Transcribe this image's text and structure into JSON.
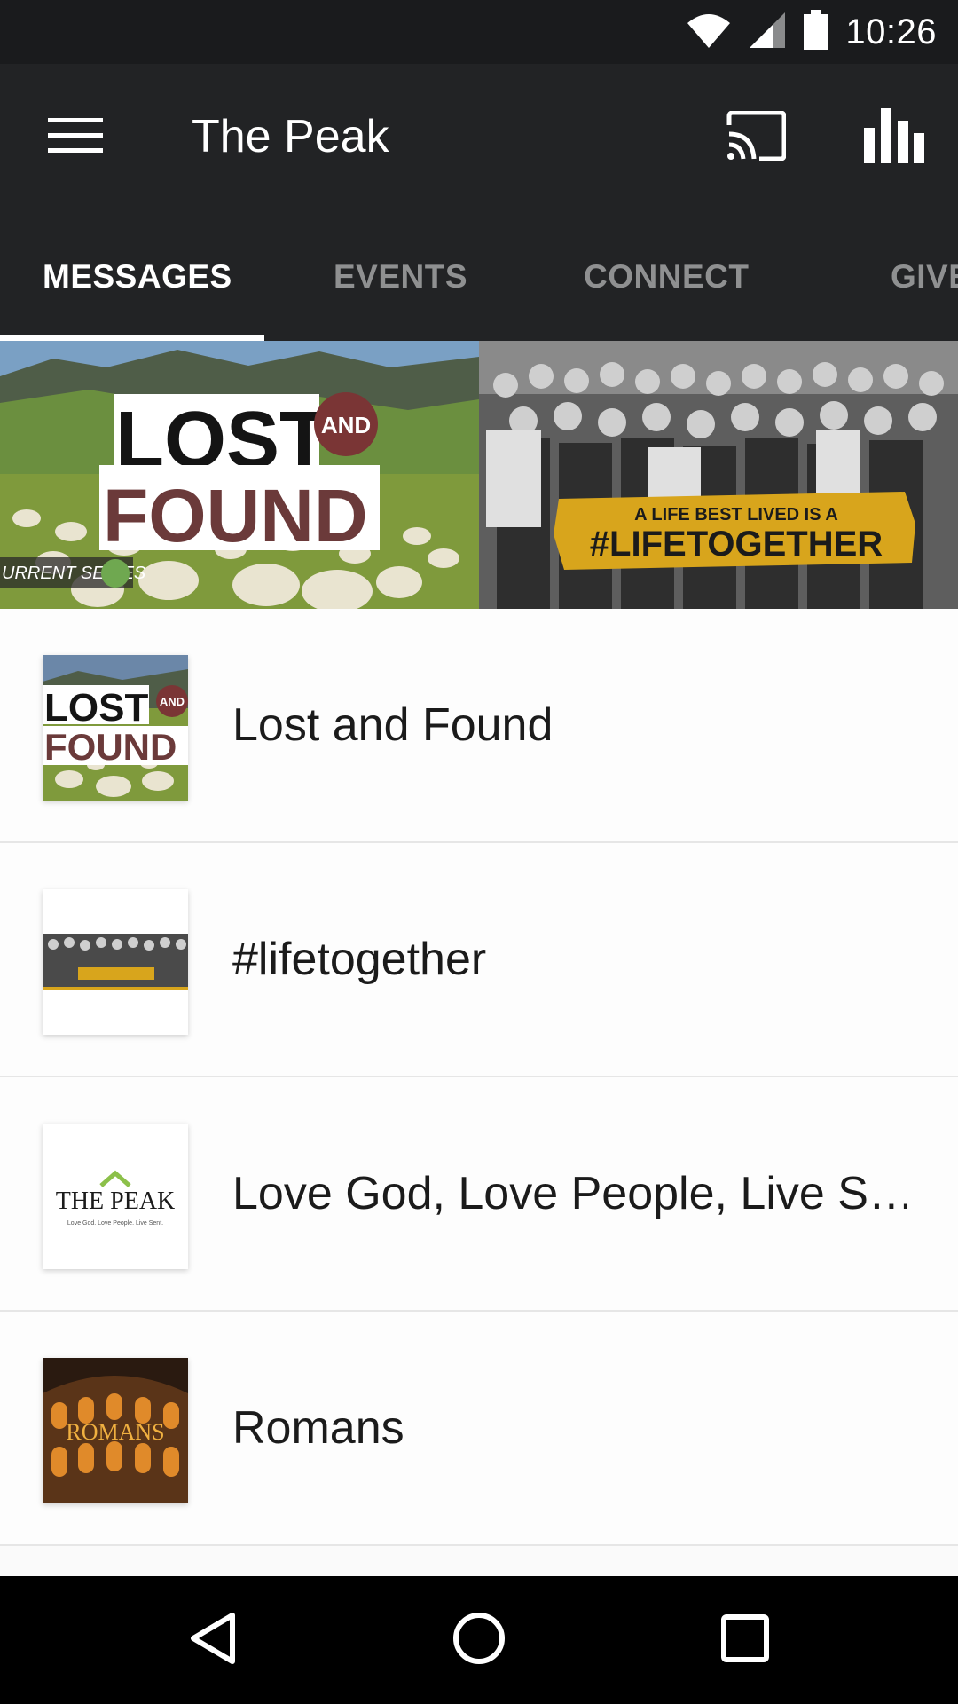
{
  "status_bar": {
    "time": "10:26",
    "icons": [
      "wifi-icon",
      "cell-signal-icon",
      "battery-icon"
    ]
  },
  "app_bar": {
    "title": "The Peak",
    "icons": [
      "menu-icon",
      "cast-icon",
      "bar-chart-icon"
    ]
  },
  "tabs": [
    {
      "label": "MESSAGES",
      "active": true
    },
    {
      "label": "EVENTS",
      "active": false
    },
    {
      "label": "CONNECT",
      "active": false
    },
    {
      "label": "GIVE",
      "active": false
    }
  ],
  "banner": {
    "left": {
      "big_word_1": "LOST",
      "and": "AND",
      "big_word_2": "FOUND",
      "tag": "URRENT SERIES"
    },
    "right": {
      "line1": "A LIFE BEST LIVED IS A",
      "line2": "#LIFETOGETHER"
    }
  },
  "series": [
    {
      "title": "Lost and Found",
      "thumb": "lost-and-found"
    },
    {
      "title": "#lifetogether",
      "thumb": "lifetogether"
    },
    {
      "title": "Love God, Love People, Live S…",
      "thumb": "the-peak-logo",
      "thumb_text": "THE PEAK",
      "thumb_sub": "Love God. Love People. Live Sent."
    },
    {
      "title": "Romans",
      "thumb": "romans",
      "thumb_text": "ROMANS"
    }
  ],
  "colors": {
    "status_bar": "#1a1b1d",
    "app_bar": "#222325",
    "tab_inactive": "#8f9091",
    "tab_active": "#ffffff",
    "banner_gold": "#d8a51c",
    "brand_maroon": "#6b3a3a"
  },
  "nav_bar": {
    "icons": [
      "back-icon",
      "home-icon",
      "recents-icon"
    ]
  }
}
